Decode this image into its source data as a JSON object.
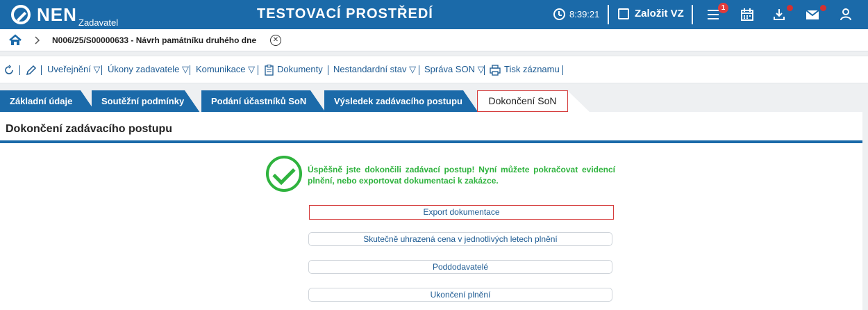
{
  "header": {
    "logo_text": "NEN",
    "logo_subtitle": "Zadavatel",
    "environment_title": "TESTOVACÍ PROSTŘEDÍ",
    "clock": "8:39:21",
    "create_label": "Založit VZ",
    "menu_badge_count": "1"
  },
  "breadcrumb": {
    "record": "N006/25/S00000633 - Návrh památníku druhého dne",
    "close_symbol": "✕"
  },
  "toolbar": {
    "items": [
      "Uveřejnění ▽",
      "Úkony zadavatele ▽",
      "Komunikace ▽",
      "Dokumenty",
      "Nestandardní stav ▽",
      "Správa SON ▽",
      "Tisk záznamu"
    ]
  },
  "tabs": [
    {
      "label": "Základní údaje"
    },
    {
      "label": "Soutěžní podmínky"
    },
    {
      "label": "Podání účastníků SoN"
    },
    {
      "label": "Výsledek zadávacího postupu"
    },
    {
      "label": "Dokončení SoN"
    }
  ],
  "panel": {
    "title": "Dokončení zadávacího postupu",
    "success_message": "Úspěšně jste dokončili zadávací postup! Nyní můžete pokračovat evidencí plnění, nebo exportovat dokumentaci k zakázce.",
    "buttons": [
      {
        "label": "Export dokumentace"
      },
      {
        "label": "Skutečně uhrazená cena v jednotlivých letech plnění"
      },
      {
        "label": "Poddodavatelé"
      },
      {
        "label": "Ukončení plnění"
      }
    ]
  },
  "colors": {
    "brand_blue": "#1b6aa9",
    "success_green": "#2fb33e",
    "highlight_red": "#d53b3b"
  }
}
